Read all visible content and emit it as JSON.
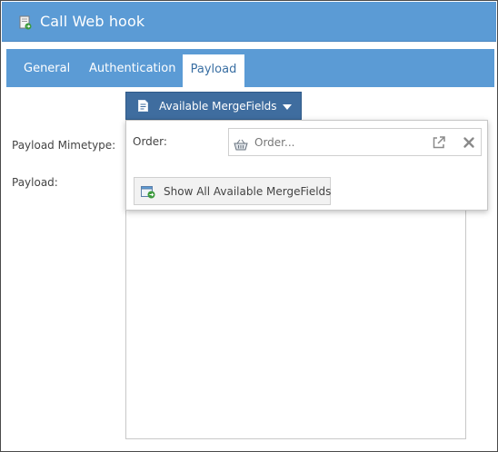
{
  "window": {
    "title": "Call Web hook",
    "title_icon": "webhook-action-icon"
  },
  "tabs": [
    {
      "label": "General",
      "active": false
    },
    {
      "label": "Authentication",
      "active": false
    },
    {
      "label": "Payload",
      "active": true
    }
  ],
  "merge_fields_button": {
    "label": "Available MergeFields",
    "icon": "document-icon"
  },
  "form": {
    "mimetype_label": "Payload Mimetype:",
    "payload_label": "Payload:"
  },
  "dropdown": {
    "order_label": "Order:",
    "order_placeholder": "Order...",
    "order_icon": "basket-icon",
    "open_icon": "external-link-icon",
    "clear_icon": "close-icon",
    "show_all_label": "Show All Available MergeFields",
    "show_all_icon": "insert-icon"
  },
  "colors": {
    "titlebar": "#5b9bd5",
    "tabbar": "#5b9bd5",
    "active_tab_text": "#3a6fa3",
    "merge_button": "#3f6d9f"
  }
}
